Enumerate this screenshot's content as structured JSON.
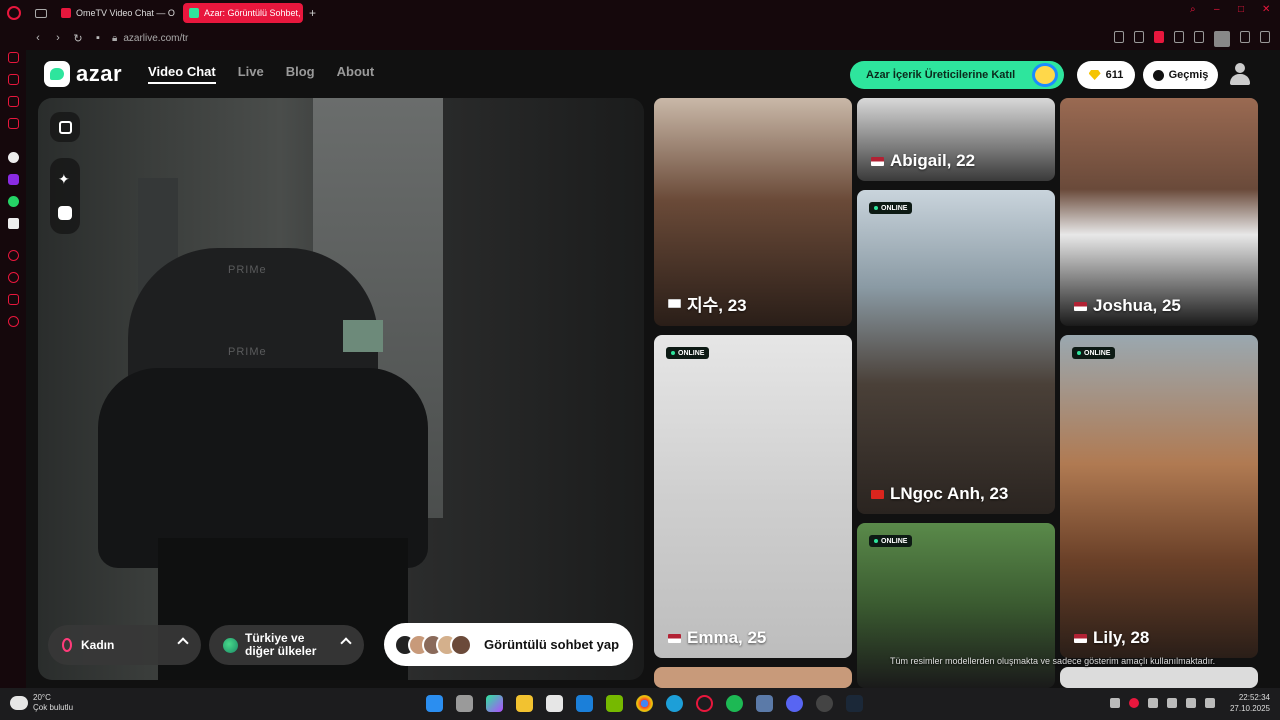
{
  "browser": {
    "tabs": [
      {
        "label": "OmeTV Video Chat — Ome",
        "active": false,
        "favicon_color": "#e8173d"
      },
      {
        "label": "Azar: Görüntülü Sohbet, Y",
        "active": true,
        "favicon_color": "#2ee59d"
      }
    ],
    "url": "azarlive.com/tr"
  },
  "header": {
    "logo_text": "azar",
    "nav": [
      "Video Chat",
      "Live",
      "Blog",
      "About"
    ],
    "creator_button": "Azar İçerik Üreticilerine Katıl",
    "coins": "611",
    "history_button": "Geçmiş"
  },
  "camera": {
    "chair_brand": "PRIMe",
    "gender_filter": "Kadın",
    "region_filter_line1": "Türkiye ve",
    "region_filter_line2": "diğer ülkeler",
    "start_button": "Görüntülü sohbet yap"
  },
  "grid": {
    "online_label": "ONLINE",
    "disclaimer": "Tüm resimler modellerden oluşmakta ve sadece gösterim amaçlı kullanılmaktadır.",
    "cards": [
      {
        "caption": "지수, 23",
        "flag": "kr"
      },
      {
        "caption": "Abigail, 22",
        "flag": "us"
      },
      {
        "caption": "Joshua, 25",
        "flag": "us"
      },
      {
        "caption": "LNgọc Anh, 23",
        "flag": "vn"
      },
      {
        "caption": "Emma, 25",
        "flag": "us"
      },
      {
        "caption": "Lily, 28",
        "flag": "us"
      }
    ]
  },
  "taskbar": {
    "temperature": "20°C",
    "weather": "Çok bulutlu",
    "time": "22:52:34",
    "date": "27.10.2025"
  },
  "colors": {
    "accent": "#2ee59d",
    "opera_red": "#e8173d"
  }
}
